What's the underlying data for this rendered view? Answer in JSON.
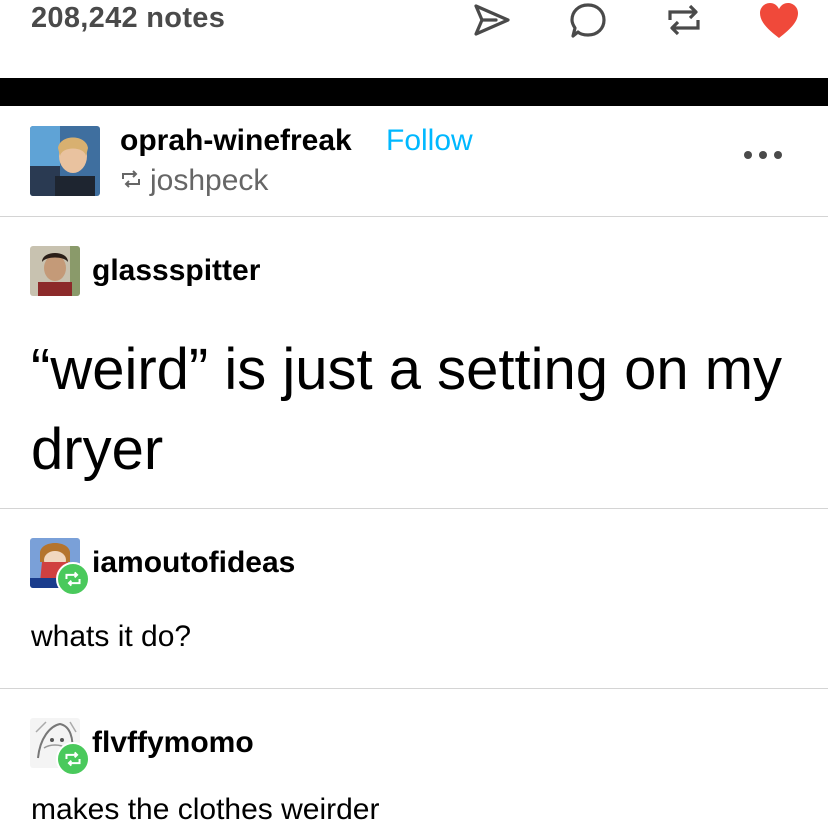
{
  "notes": {
    "count_label": "208,242 notes"
  },
  "actions": {
    "share": "share-icon",
    "reply": "reply-icon",
    "reblog": "reblog-icon",
    "like": "heart-icon",
    "like_color": "#f0493a"
  },
  "post": {
    "blog_name": "oprah-winefreak",
    "follow_label": "Follow",
    "reblogged_from": "joshpeck",
    "more": "more-icon"
  },
  "thread": [
    {
      "username": "glassspitter",
      "text": "“weird” is just a setting on my dryer"
    },
    {
      "username": "iamoutofideas",
      "text": "whats it do?"
    },
    {
      "username": "flvffymomo",
      "text": "makes the clothes weirder"
    }
  ],
  "colors": {
    "accent": "#00b8ff",
    "reblog_badge": "#4ac95c"
  }
}
